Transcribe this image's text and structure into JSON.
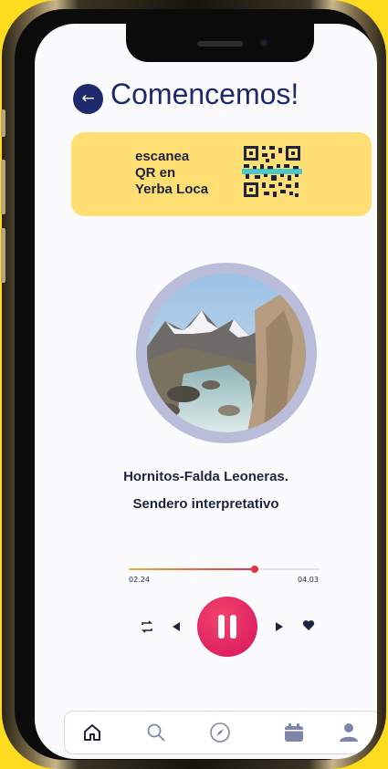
{
  "header": {
    "title": "Comencemos!",
    "back_label": "←"
  },
  "qr_card": {
    "line1": "escanea",
    "line2": "QR en",
    "line3": "Yerba Loca"
  },
  "track": {
    "title_line1": "Hornitos-Falda Leoneras.",
    "title_line2": "Sendero interpretativo"
  },
  "player": {
    "elapsed": "02.24",
    "total": "04.03",
    "progress_fraction": 0.66,
    "repeat_icon": "repeat-icon",
    "prev_icon": "previous-icon",
    "pause_icon": "pause-icon",
    "next_icon": "next-icon",
    "like_icon": "heart-icon"
  },
  "nav": {
    "items": [
      "home-icon",
      "search-icon",
      "compass-icon",
      "calendar-icon",
      "profile-icon"
    ]
  },
  "colors": {
    "background": "#FDDB1E",
    "primary": "#1E2A6B",
    "card": "#FFDF73",
    "accent": "#E1304C",
    "nav_icon": "#7D86A8"
  }
}
